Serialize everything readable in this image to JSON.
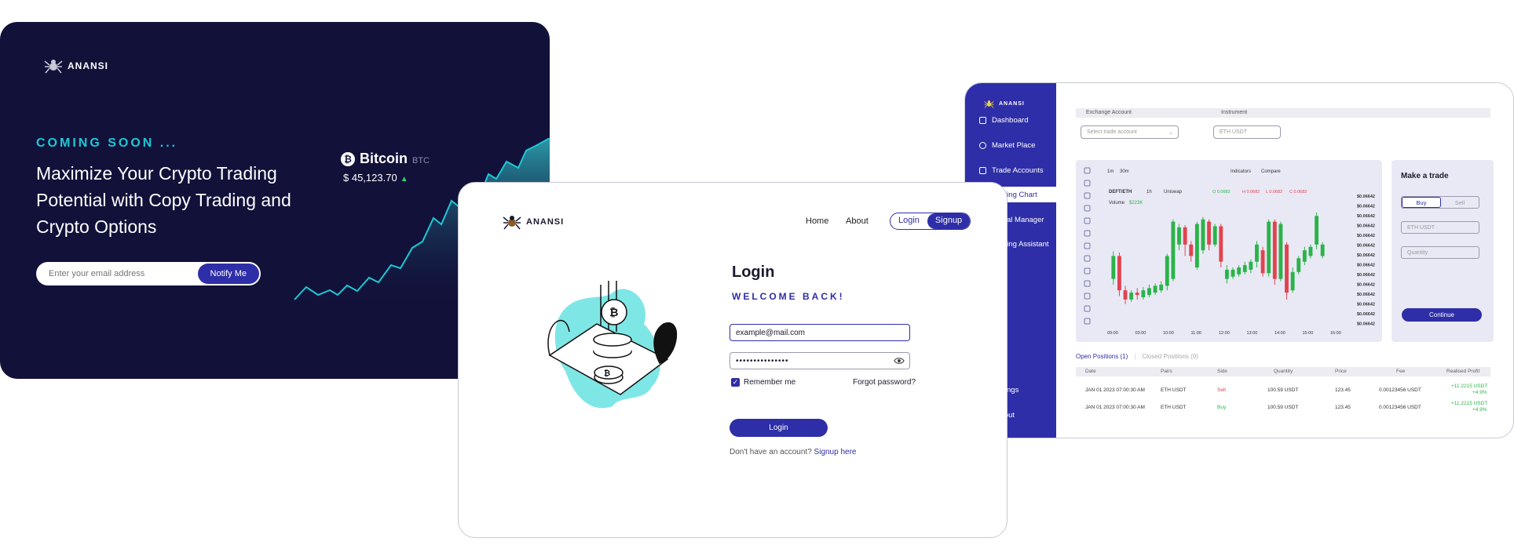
{
  "brand": "ANANSI",
  "coming_soon": {
    "eyebrow": "COMING SOON ...",
    "headline": "Maximize Your Crypto Trading Potential with Copy Trading and Crypto Options",
    "email_placeholder": "Enter your email address",
    "notify_label": "Notify Me",
    "ticker": {
      "name": "Bitcoin",
      "symbol": "BTC",
      "price": "$ 45,123.70",
      "trend": "up"
    }
  },
  "login": {
    "nav": {
      "home": "Home",
      "about": "About",
      "login": "Login",
      "signup": "Signup"
    },
    "title": "Login",
    "welcome": "WELCOME BACK!",
    "email_value": "example@mail.com",
    "password_mask": "•••••••••••••••",
    "remember": "Remember me",
    "forgot": "Forgot password?",
    "submit": "Login",
    "no_account": "Don't have an account?",
    "signup_link": "Signup here"
  },
  "dashboard": {
    "sidebar": {
      "items": [
        {
          "label": "Dashboard"
        },
        {
          "label": "Market Place"
        },
        {
          "label": "Trade Accounts"
        },
        {
          "label": "Trading Chart"
        },
        {
          "label": "Signal Manager"
        },
        {
          "label": "Trading Assistant"
        }
      ],
      "active": "Trading Chart",
      "settings": "Settings",
      "logout": "Logout"
    },
    "exchange_label": "Exchange Account",
    "instrument_label": "Instrument",
    "account_placeholder": "Select trade account",
    "instrument_placeholder": "ETH USDT",
    "chart_toolbar": {
      "timeframes": [
        "1m",
        "30m"
      ],
      "indicators": "Indicators",
      "compare": "Compare"
    },
    "chart_info": {
      "pair": "DEFT/ETH",
      "interval": "1h",
      "exchange": "Uniswap",
      "open": "O 0.0682",
      "high": "H 0.0682",
      "low": "L 0.0682",
      "close": "C 0.0682",
      "volume_label": "Volume",
      "volume": "$223K"
    },
    "chart_data": {
      "type": "candlestick",
      "x_ticks": [
        "09:00",
        "03:00",
        "10:00",
        "11:00",
        "12:00",
        "13:00",
        "14:00",
        "15:00",
        "16:00"
      ],
      "y_tick_label": "$0.06642",
      "y_tick_count": 14,
      "candles": [
        {
          "o": 0.4,
          "c": 0.6,
          "h": 0.64,
          "l": 0.35
        },
        {
          "o": 0.6,
          "c": 0.3,
          "h": 0.63,
          "l": 0.25
        },
        {
          "o": 0.3,
          "c": 0.22,
          "h": 0.34,
          "l": 0.18
        },
        {
          "o": 0.22,
          "c": 0.28,
          "h": 0.3,
          "l": 0.2
        },
        {
          "o": 0.28,
          "c": 0.26,
          "h": 0.32,
          "l": 0.22
        },
        {
          "o": 0.24,
          "c": 0.3,
          "h": 0.33,
          "l": 0.22
        },
        {
          "o": 0.26,
          "c": 0.32,
          "h": 0.35,
          "l": 0.24
        },
        {
          "o": 0.28,
          "c": 0.34,
          "h": 0.36,
          "l": 0.26
        },
        {
          "o": 0.3,
          "c": 0.35,
          "h": 0.38,
          "l": 0.28
        },
        {
          "o": 0.34,
          "c": 0.6,
          "h": 0.62,
          "l": 0.3
        },
        {
          "o": 0.4,
          "c": 0.9,
          "h": 0.92,
          "l": 0.38
        },
        {
          "o": 0.7,
          "c": 0.85,
          "h": 0.88,
          "l": 0.65
        },
        {
          "o": 0.85,
          "c": 0.7,
          "h": 0.87,
          "l": 0.6
        },
        {
          "o": 0.7,
          "c": 0.6,
          "h": 0.73,
          "l": 0.55
        },
        {
          "o": 0.5,
          "c": 0.88,
          "h": 0.9,
          "l": 0.48
        },
        {
          "o": 0.65,
          "c": 0.92,
          "h": 0.94,
          "l": 0.62
        },
        {
          "o": 0.9,
          "c": 0.7,
          "h": 0.92,
          "l": 0.65
        },
        {
          "o": 0.7,
          "c": 0.86,
          "h": 0.88,
          "l": 0.68
        },
        {
          "o": 0.86,
          "c": 0.55,
          "h": 0.88,
          "l": 0.5
        },
        {
          "o": 0.4,
          "c": 0.48,
          "h": 0.52,
          "l": 0.36
        },
        {
          "o": 0.42,
          "c": 0.48,
          "h": 0.5,
          "l": 0.4
        },
        {
          "o": 0.44,
          "c": 0.5,
          "h": 0.52,
          "l": 0.42
        },
        {
          "o": 0.46,
          "c": 0.52,
          "h": 0.55,
          "l": 0.44
        },
        {
          "o": 0.48,
          "c": 0.55,
          "h": 0.57,
          "l": 0.45
        },
        {
          "o": 0.55,
          "c": 0.7,
          "h": 0.73,
          "l": 0.5
        },
        {
          "o": 0.65,
          "c": 0.45,
          "h": 0.68,
          "l": 0.42
        },
        {
          "o": 0.45,
          "c": 0.9,
          "h": 0.92,
          "l": 0.42
        },
        {
          "o": 0.9,
          "c": 0.4,
          "h": 0.92,
          "l": 0.35
        },
        {
          "o": 0.4,
          "c": 0.88,
          "h": 0.9,
          "l": 0.38
        },
        {
          "o": 0.7,
          "c": 0.28,
          "h": 0.72,
          "l": 0.22
        },
        {
          "o": 0.3,
          "c": 0.46,
          "h": 0.5,
          "l": 0.28
        },
        {
          "o": 0.46,
          "c": 0.58,
          "h": 0.6,
          "l": 0.44
        },
        {
          "o": 0.55,
          "c": 0.65,
          "h": 0.68,
          "l": 0.52
        },
        {
          "o": 0.6,
          "c": 0.68,
          "h": 0.7,
          "l": 0.58
        },
        {
          "o": 0.7,
          "c": 0.95,
          "h": 0.98,
          "l": 0.66
        },
        {
          "o": 0.6,
          "c": 0.7,
          "h": 0.72,
          "l": 0.58
        }
      ]
    },
    "trade": {
      "title": "Make a trade",
      "buy": "Buy",
      "sell": "Sell",
      "instrument_placeholder": "ETH USDT",
      "quantity_placeholder": "Quantity",
      "continue": "Continue"
    },
    "positions": {
      "open_tab": "Open Positions (1)",
      "closed_tab": "Closed Positions (0)",
      "columns": [
        "Date",
        "Pairs",
        "Side",
        "Quantity",
        "Price",
        "Fee",
        "Realised Profit"
      ],
      "rows": [
        {
          "date": "JAN 01 2023 07:00:30 AM",
          "pair": "ETH USDT",
          "side": "Sell",
          "quantity": "100.59 USDT",
          "price": "123.45",
          "fee": "0.00123456 USDT",
          "profit": "+11.2215 USDT",
          "profit_pct": "+4.9%"
        },
        {
          "date": "JAN 01 2023 07:00:30 AM",
          "pair": "ETH USDT",
          "side": "Buy",
          "quantity": "100.59 USDT",
          "price": "123.45",
          "fee": "0.00123456 USDT",
          "profit": "+11.2215 USDT",
          "profit_pct": "+4.9%"
        }
      ]
    }
  },
  "colors": {
    "navy": "#12113a",
    "brand_blue": "#2e2ea8",
    "teal": "#1cc9d4",
    "up": "#2bb34a",
    "down": "#e0444f"
  }
}
